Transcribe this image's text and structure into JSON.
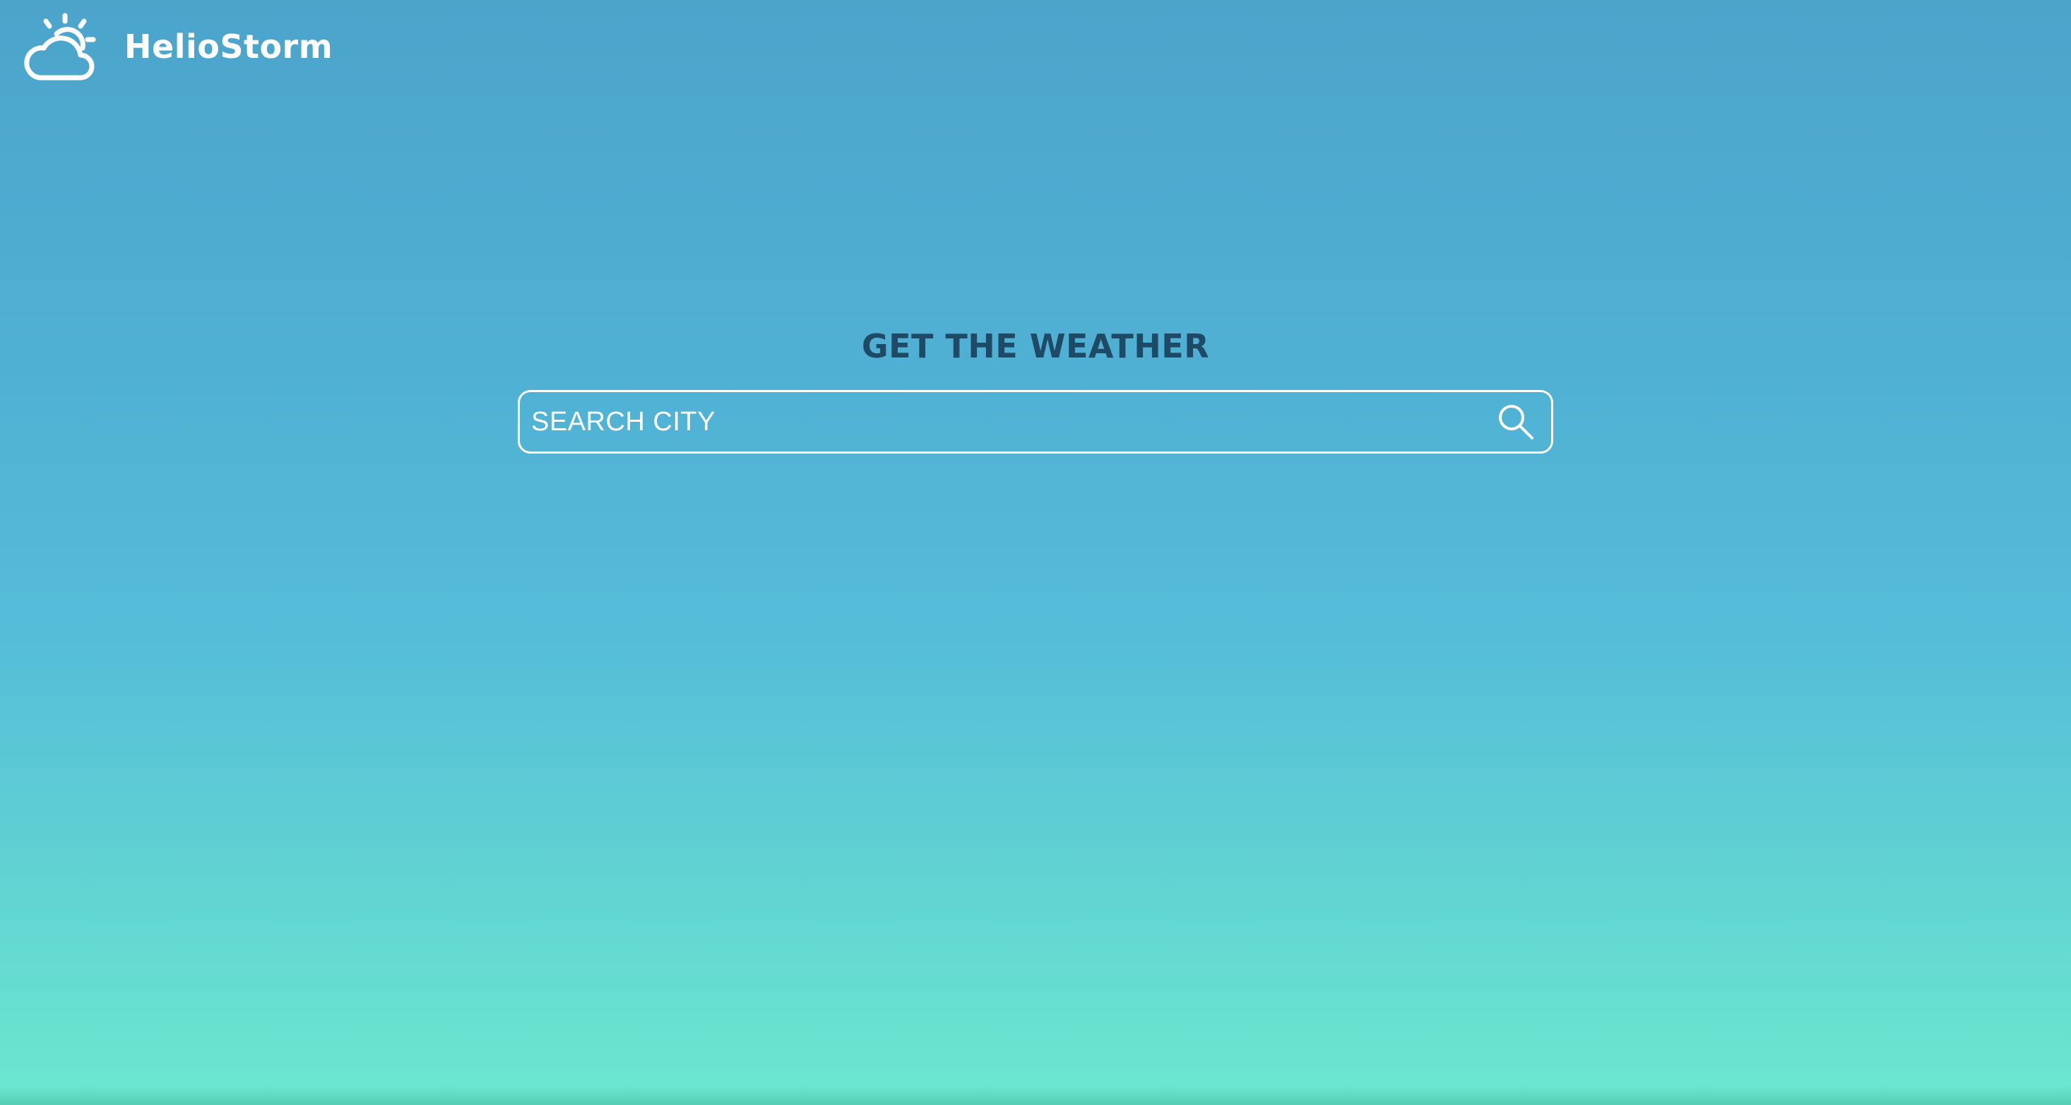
{
  "header": {
    "logo_icon": "sun-cloud-icon",
    "brand_name": "HelioStorm"
  },
  "hero": {
    "title": "GET THE WEATHER"
  },
  "search": {
    "placeholder": "SEARCH CITY",
    "value": "",
    "button_icon": "search-icon"
  },
  "colors": {
    "gradient_top": "#4ca4cb",
    "gradient_bottom": "#6ce8cf",
    "title_text": "#1e4a66",
    "foreground": "#ffffff"
  }
}
